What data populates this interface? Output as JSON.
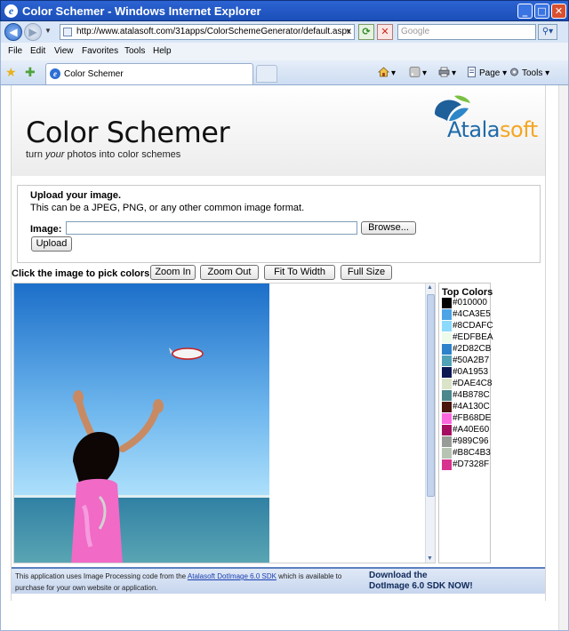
{
  "window": {
    "title": "Color Schemer - Windows Internet Explorer",
    "url": "http://www.atalasoft.com/31apps/ColorSchemeGenerator/default.aspx",
    "search_placeholder": "Google"
  },
  "menu": [
    "File",
    "Edit",
    "View",
    "Favorites",
    "Tools",
    "Help"
  ],
  "tab": {
    "label": "Color Schemer"
  },
  "toolbar": {
    "page_label": "Page",
    "tools_label": "Tools"
  },
  "header": {
    "title": "Color Schemer",
    "tagline_pre": "turn ",
    "tagline_em": "your",
    "tagline_post": " photos into color schemes",
    "logo_main": "Atala",
    "logo_accent": "soft"
  },
  "upload": {
    "title": "Upload your image.",
    "description": "This can be a JPEG, PNG, or any other common image format.",
    "image_label": "Image:",
    "browse_label": "Browse...",
    "upload_label": "Upload"
  },
  "controls": {
    "prompt": "Click the image to pick colors.",
    "zoom_in": "Zoom In",
    "zoom_out": "Zoom Out",
    "fit_to_width": "Fit To Width",
    "full_size": "Full Size"
  },
  "top_colors": {
    "title": "Top Colors",
    "items": [
      {
        "hex": "#010000"
      },
      {
        "hex": "#4CA3E5"
      },
      {
        "hex": "#8CDAFC"
      },
      {
        "hex": "#EDFBEA"
      },
      {
        "hex": "#2D82CB"
      },
      {
        "hex": "#50A2B7"
      },
      {
        "hex": "#0A1953"
      },
      {
        "hex": "#DAE4C8"
      },
      {
        "hex": "#4B878C"
      },
      {
        "hex": "#4A130C"
      },
      {
        "hex": "#FB68DE"
      },
      {
        "hex": "#A40E60"
      },
      {
        "hex": "#989C96"
      },
      {
        "hex": "#B8C4B3"
      },
      {
        "hex": "#D7328F"
      }
    ]
  },
  "footer": {
    "text_pre": "This application uses Image Processing code from the ",
    "link": "Atalasoft DotImage 6.0 SDK",
    "text_post": " which is available to purchase for your own website or application.",
    "cta_line1": "Download the",
    "cta_line2": "DotImage 6.0 SDK NOW!"
  },
  "icons": [
    "ie-logo-icon",
    "back-icon",
    "forward-icon",
    "refresh-icon",
    "stop-icon",
    "search-icon",
    "favorites-star-icon",
    "add-favorites-icon",
    "home-icon",
    "feeds-icon",
    "print-icon",
    "page-icon",
    "tools-gear-icon"
  ]
}
